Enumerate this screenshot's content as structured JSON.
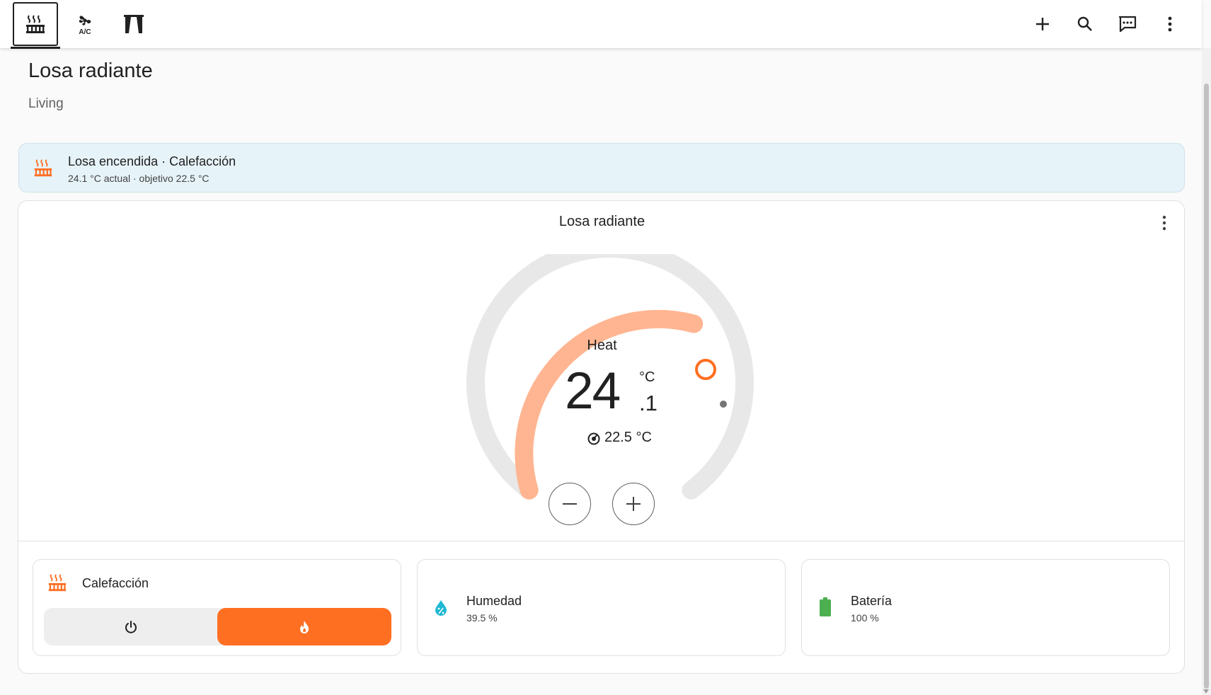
{
  "header": {
    "tabs": [
      {
        "icon": "radiator-icon",
        "active": true
      },
      {
        "icon": "air-conditioner-icon",
        "active": false
      },
      {
        "icon": "curtains-icon",
        "active": false
      }
    ],
    "actions": [
      "add-icon",
      "search-icon",
      "assist-icon",
      "more-vert-icon"
    ]
  },
  "page": {
    "title": "Losa radiante",
    "subtitle": "Living"
  },
  "status": {
    "icon": "radiator-icon",
    "title": "Losa encendida · Calefacción",
    "detail": "24.1 °C actual · objetivo 22.5 °C"
  },
  "thermostat": {
    "name": "Losa radiante",
    "mode": "Heat",
    "current_integer": "24",
    "current_decimal": ".1",
    "unit": "°C",
    "target": "22.5 °C",
    "accent_color": "#ff6f22",
    "arc_color": "#ffb591"
  },
  "features": {
    "hvac": {
      "icon": "radiator-icon",
      "name": "Calefacción",
      "options": [
        "power-icon",
        "fire-icon"
      ],
      "selected": "fire-icon"
    },
    "humidity": {
      "icon": "water-percent-icon",
      "name": "Humedad",
      "value": "39.5 %",
      "icon_color": "#1fb8d4"
    },
    "battery": {
      "icon": "battery-icon",
      "name": "Batería",
      "value": "100 %",
      "icon_color": "#4caf50"
    }
  }
}
